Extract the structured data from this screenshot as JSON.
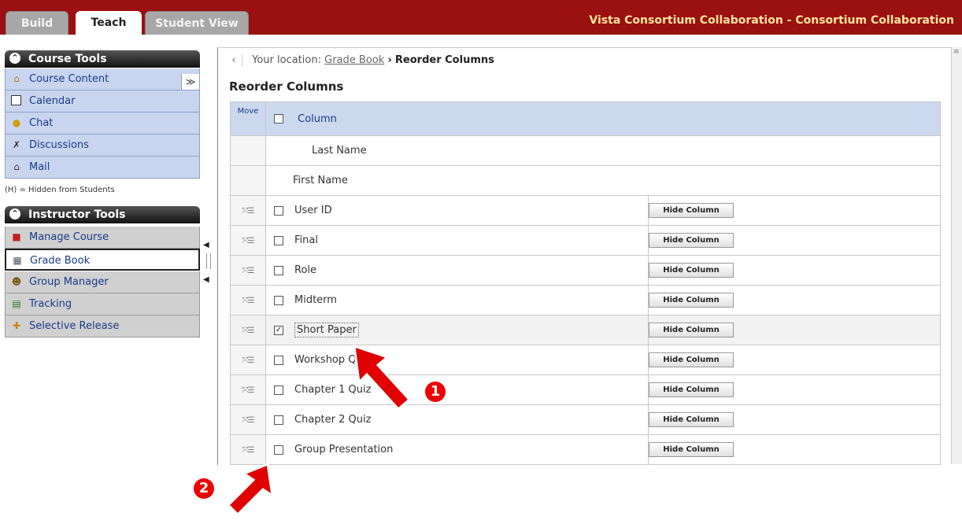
{
  "tabs": [
    "Build",
    "Teach",
    "Student View"
  ],
  "app_title": "Vista Consortium Collaboration - Consortium Collaboration",
  "course_tools": {
    "header": "Course Tools",
    "items": [
      {
        "label": "Course Content",
        "icon": "house-icon"
      },
      {
        "label": "Calendar",
        "icon": "calendar-icon"
      },
      {
        "label": "Chat",
        "icon": "chat-bubble-icon"
      },
      {
        "label": "Discussions",
        "icon": "pushpin-icon"
      },
      {
        "label": "Mail",
        "icon": "envelope-icon"
      }
    ],
    "collapse_glyph": "≫"
  },
  "hidden_note": "(H) = Hidden from Students",
  "instructor_tools": {
    "header": "Instructor Tools",
    "items": [
      {
        "label": "Manage Course",
        "icon": "bricks-icon"
      },
      {
        "label": "Grade Book",
        "icon": "gradebook-icon"
      },
      {
        "label": "Group Manager",
        "icon": "group-icon"
      },
      {
        "label": "Tracking",
        "icon": "chart-icon"
      },
      {
        "label": "Selective Release",
        "icon": "release-icon"
      }
    ]
  },
  "breadcrumb": {
    "prefix": "Your location:",
    "link": "Grade Book",
    "separator": "›",
    "current": "Reorder Columns"
  },
  "page_title": "Reorder Columns",
  "table": {
    "move_header": "Move",
    "column_header": "Column",
    "hide_label": "Hide Column",
    "fixed_rows": [
      "Last Name",
      "First Name"
    ],
    "rows": [
      {
        "label": "User ID",
        "checked": false
      },
      {
        "label": "Final",
        "checked": false
      },
      {
        "label": "Role",
        "checked": false
      },
      {
        "label": "Midterm",
        "checked": false
      },
      {
        "label": "Short Paper",
        "checked": true
      },
      {
        "label": "Workshop Quiz",
        "checked": false
      },
      {
        "label": "Chapter 1 Quiz",
        "checked": false
      },
      {
        "label": "Chapter 2 Quiz",
        "checked": false
      },
      {
        "label": "Group Presentation",
        "checked": false
      }
    ]
  },
  "annotations": {
    "one": "1",
    "two": "2"
  },
  "colors": {
    "topbar": "#9b1010",
    "title": "#ffe6a0",
    "accent_red": "#e00000",
    "sidebar_blue": "#c9d5ef"
  }
}
